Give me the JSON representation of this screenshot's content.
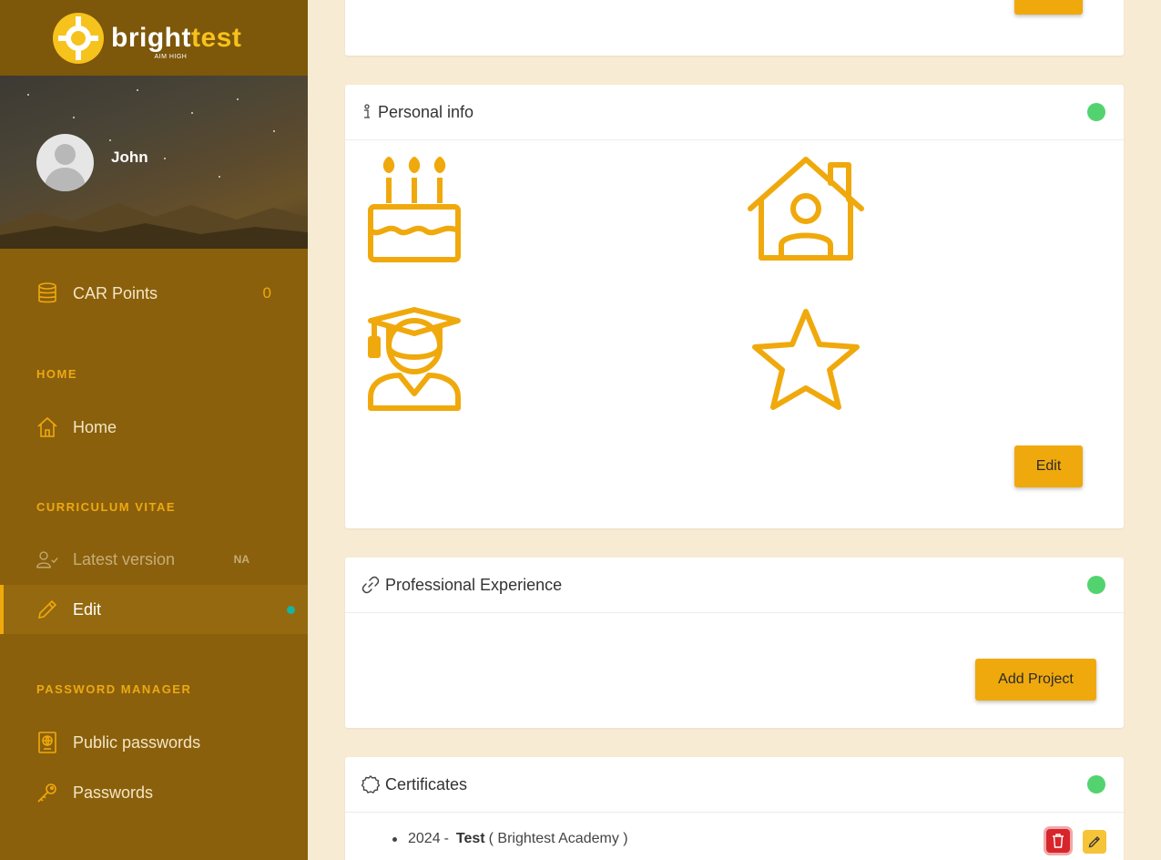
{
  "brand": {
    "name_part1": "bright",
    "name_part2": "test",
    "tagline": "AIM HIGH"
  },
  "user": {
    "name": "John"
  },
  "sidebar": {
    "car_points": {
      "label": "CAR Points",
      "value": "0"
    },
    "section_home": "HOME",
    "home": "Home",
    "section_cv": "CURRICULUM VITAE",
    "latest_version": {
      "label": "Latest version",
      "badge": "NA"
    },
    "edit": "Edit",
    "section_password": "PASSWORD MANAGER",
    "public_passwords": "Public passwords",
    "passwords": "Passwords"
  },
  "cards": {
    "top": {
      "button": ""
    },
    "personal_info": {
      "title": "Personal info",
      "edit_label": "Edit",
      "status": "complete"
    },
    "professional": {
      "title": "Professional Experience",
      "add_label": "Add Project",
      "status": "complete"
    },
    "certificates": {
      "title": "Certificates",
      "status": "complete",
      "items": [
        {
          "year": "2024",
          "sep": "-",
          "name": "Test",
          "issuer": "( Brightest Academy )"
        }
      ]
    }
  },
  "colors": {
    "accent": "#f0a90c",
    "sidebar": "#8a600c",
    "status_ok": "#53d36f",
    "background": "#f8ebd3"
  }
}
